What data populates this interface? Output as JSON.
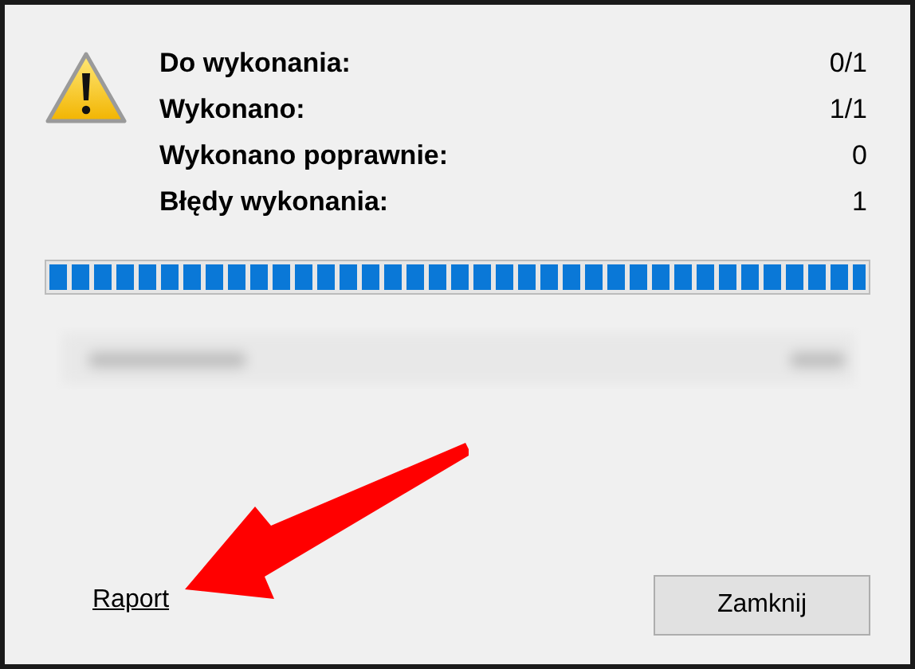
{
  "stats": [
    {
      "label": "Do wykonania:",
      "value": "0/1"
    },
    {
      "label": "Wykonano:",
      "value": "1/1"
    },
    {
      "label": "Wykonano poprawnie:",
      "value": "0"
    },
    {
      "label": "Błędy wykonania:",
      "value": "1"
    }
  ],
  "progress": {
    "level": 1
  },
  "report_link": "Raport",
  "buttons": [
    "Zamknij"
  ]
}
